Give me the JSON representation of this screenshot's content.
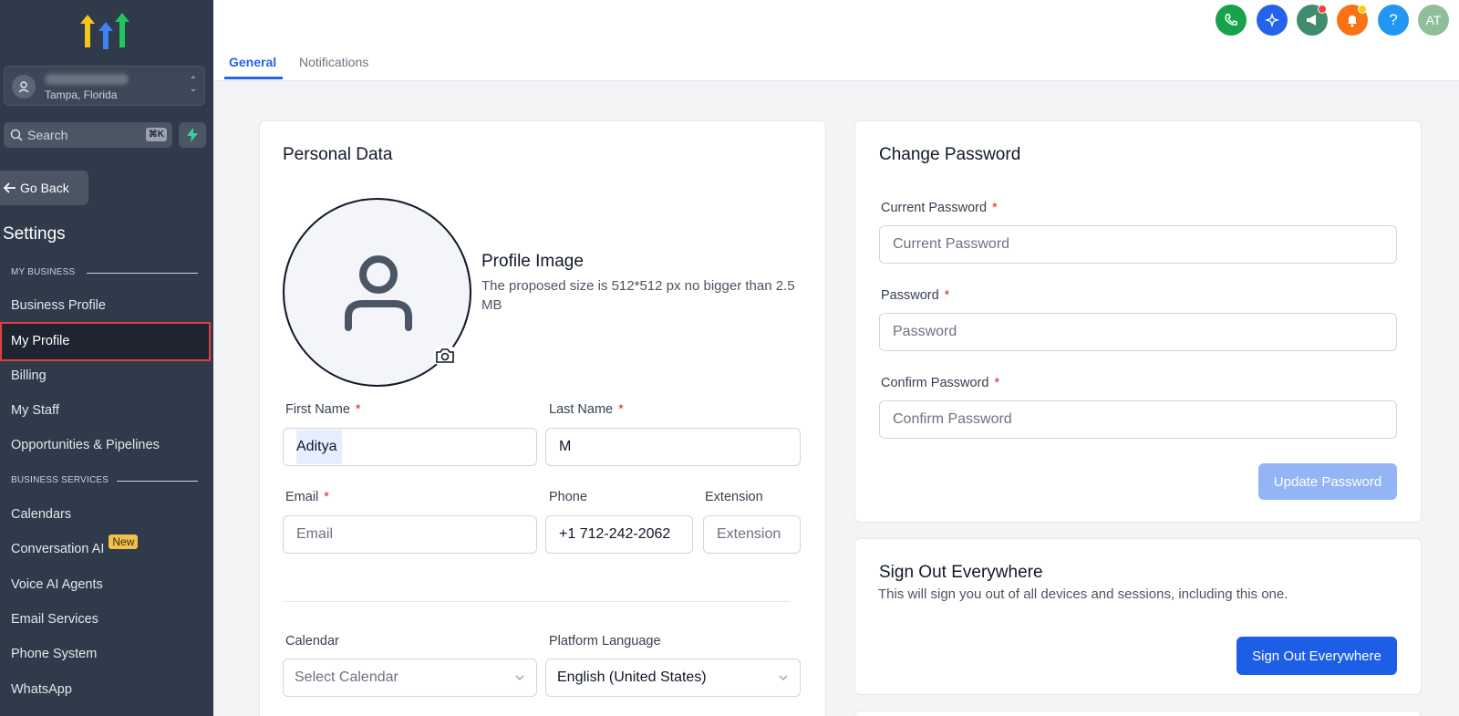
{
  "sidebar": {
    "location_sub": "Tampa, Florida",
    "search_placeholder": "Search",
    "search_shortcut": "⌘K",
    "go_back": "Go Back",
    "settings_title": "Settings",
    "sections": {
      "my_business": "MY BUSINESS",
      "business_services": "BUSINESS SERVICES"
    },
    "items": {
      "business_profile": "Business Profile",
      "my_profile": "My Profile",
      "billing": "Billing",
      "my_staff": "My Staff",
      "opportunities": "Opportunities & Pipelines",
      "calendars": "Calendars",
      "conversation_ai": "Conversation AI",
      "conversation_ai_badge": "New",
      "voice_ai": "Voice AI Agents",
      "email_services": "Email Services",
      "phone_system": "Phone System",
      "whatsapp": "WhatsApp"
    }
  },
  "header": {
    "tabs": {
      "general": "General",
      "notifications": "Notifications"
    },
    "icons": [
      "phone-icon",
      "sparkle-icon",
      "megaphone-icon",
      "bell-icon",
      "help-icon",
      "user-avatar"
    ],
    "avatar_initials": "AT",
    "help_glyph": "?"
  },
  "personal": {
    "title": "Personal Data",
    "profile_image_title": "Profile Image",
    "profile_image_desc": "The proposed size is 512*512 px no bigger than 2.5 MB",
    "first_name_label": "First Name",
    "first_name_value": "Aditya",
    "last_name_label": "Last Name",
    "last_name_value": "M",
    "email_label": "Email",
    "email_placeholder": "Email",
    "phone_label": "Phone",
    "phone_value": "+1 712-242-2062",
    "extension_label": "Extension",
    "extension_placeholder": "Extension",
    "calendar_label": "Calendar",
    "calendar_placeholder": "Select Calendar",
    "language_label": "Platform Language",
    "language_value": "English (United States)",
    "required_mark": "*"
  },
  "password": {
    "title": "Change Password",
    "current_label": "Current Password",
    "current_placeholder": "Current Password",
    "password_label": "Password",
    "password_placeholder": "Password",
    "confirm_label": "Confirm Password",
    "confirm_placeholder": "Confirm Password",
    "update_button": "Update Password"
  },
  "signout": {
    "title": "Sign Out Everywhere",
    "description": "This will sign you out of all devices and sessions, including this one.",
    "button": "Sign Out Everywhere"
  },
  "colors": {
    "sidebar_bg": "#2f3a4a",
    "accent": "#2563eb",
    "active_outline": "#e53e3e",
    "required": "#dc2626"
  }
}
